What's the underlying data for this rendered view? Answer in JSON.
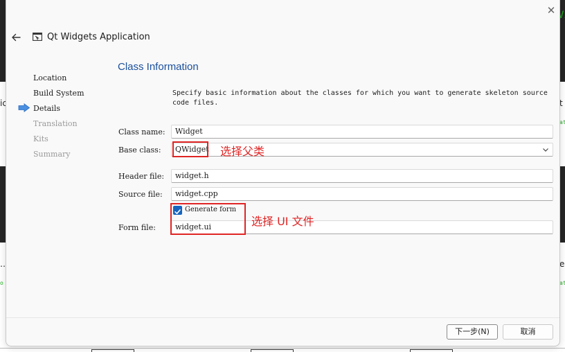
{
  "wizard": {
    "title": "Qt Widgets Application",
    "close_glyph": "✕",
    "steps": [
      {
        "label": "Location",
        "state": "done"
      },
      {
        "label": "Build System",
        "state": "done"
      },
      {
        "label": "Details",
        "state": "current"
      },
      {
        "label": "Translation",
        "state": "pending"
      },
      {
        "label": "Kits",
        "state": "pending"
      },
      {
        "label": "Summary",
        "state": "pending"
      }
    ]
  },
  "page": {
    "title": "Class Information",
    "description": "Specify basic information about the classes for which you want to generate skeleton source code files."
  },
  "form": {
    "class_name_label": "Class name:",
    "class_name_value": "Widget",
    "base_class_label": "Base class:",
    "base_class_value": "QWidget",
    "header_file_label": "Header file:",
    "header_file_value": "widget.h",
    "source_file_label": "Source file:",
    "source_file_value": "widget.cpp",
    "generate_form_label": "Generate form",
    "generate_form_checked": true,
    "form_file_label": "Form file:",
    "form_file_value": "widget.ui"
  },
  "annotations": {
    "base_class_note": "选择父类",
    "form_note": "选择 UI 文件"
  },
  "buttons": {
    "next": "下一步(N)",
    "cancel": "取消"
  },
  "background": {
    "left_cut_text": "ic",
    "right_cut_text": "t",
    "left_dots": "…",
    "right_letter": "e",
    "left_green": "o",
    "right_green": "at",
    "top_right_green": "Vi"
  },
  "colors": {
    "accent": "#1565c0",
    "title_blue": "#1a4f9c",
    "annotation_red": "#e02424",
    "step_arrow": "#4a8fe0"
  }
}
